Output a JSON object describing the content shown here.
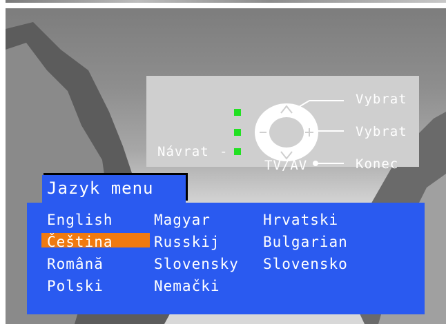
{
  "help": {
    "back_label": "Návrat",
    "back_dash": "-",
    "select_up_label": "Vybrat",
    "select_right_label": "Vybrat",
    "exit_source_label": "TV/AV",
    "exit_label": "Konec"
  },
  "menu": {
    "title": "Jazyk menu",
    "selected": "Čeština",
    "languages": {
      "col1": [
        "English",
        "Čeština",
        "Română",
        "Polski"
      ],
      "col2": [
        "Magyar",
        "Russkij",
        "Slovensky",
        "Nemački"
      ],
      "col3": [
        "Hrvatski",
        "Bulgarian",
        "Slovensko"
      ]
    }
  },
  "colors": {
    "panel_blue": "#2a5af0",
    "highlight_orange": "#f07a10",
    "indicator_green": "#22e022"
  },
  "icons": [
    "remote-dpad-icon",
    "green-indicator-icon"
  ]
}
